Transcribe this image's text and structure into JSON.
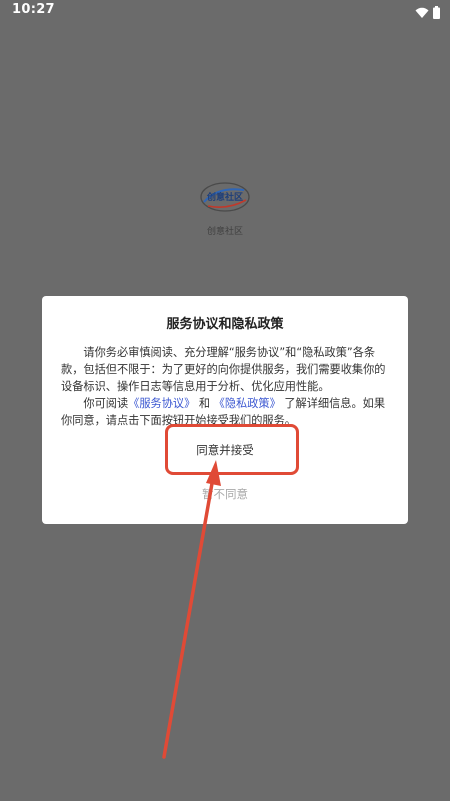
{
  "status_bar": {
    "time": "10:27",
    "icons": [
      "wifi-icon",
      "battery-icon"
    ]
  },
  "splash": {
    "logo_text": "创意社区",
    "app_name": "创意社区"
  },
  "dialog": {
    "title": "服务协议和隐私政策",
    "paragraph1": "请你务必审慎阅读、充分理解“服务协议”和“隐私政策”各条款，包括但不限于：为了更好的向你提供服务，我们需要收集你的设备标识、操作日志等信息用于分析、优化应用性能。",
    "paragraph2_prefix": "你可阅读",
    "service_agreement_link": "《服务协议》",
    "paragraph2_and": "和",
    "privacy_policy_link": "《隐私政策》",
    "paragraph2_suffix": "了解详细信息。如果你同意，请点击下面按钮开始接受我们的服务。",
    "agree_label": "同意并接受",
    "disagree_label": "暂不同意"
  },
  "colors": {
    "overlay": "#6b6b6b",
    "link": "#3b57d1",
    "annotation": "#e04a36"
  }
}
